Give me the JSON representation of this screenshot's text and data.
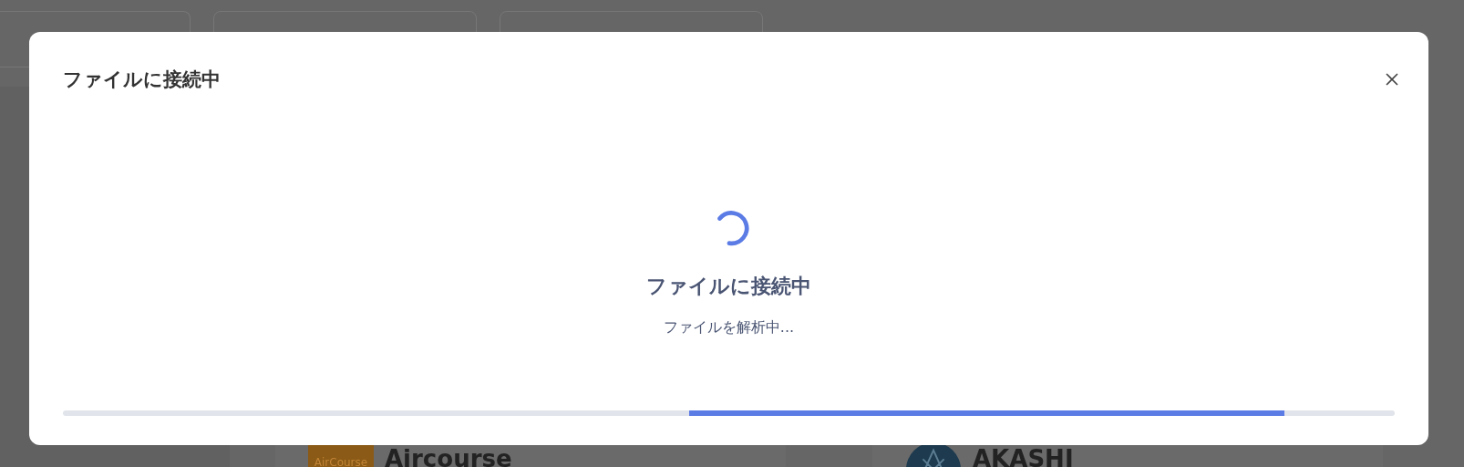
{
  "background": {
    "cards": [
      {
        "name": "Aircourse",
        "logo": "AirCourse",
        "kind": "square"
      },
      {
        "name": "AKASHI",
        "kind": "round"
      }
    ]
  },
  "dialog": {
    "title": "ファイルに接続中",
    "status_title": "ファイルに接続中",
    "status_detail": "ファイルを解析中..."
  }
}
